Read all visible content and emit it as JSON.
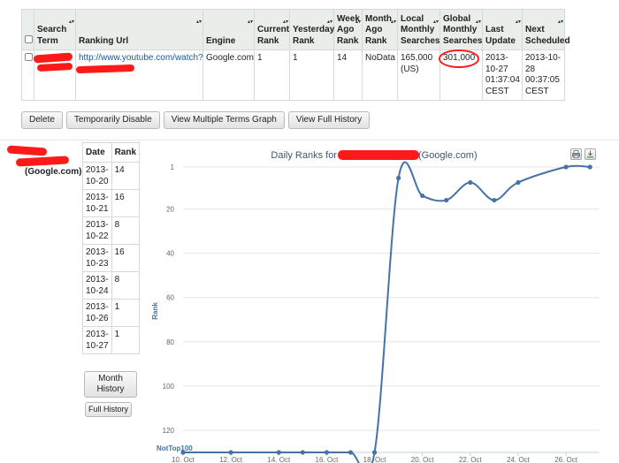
{
  "table": {
    "headers": {
      "search_term": "Search Term",
      "ranking_url": "Ranking Url",
      "engine": "Engine",
      "current_rank": "Current Rank",
      "yesterday_rank": "Yesterday Rank",
      "week_ago_rank": "Week Ago Rank",
      "month_ago_rank": "Month Ago Rank",
      "local_monthly": "Local Monthly Searches",
      "global_monthly": "Global Monthly Searches",
      "last_update": "Last Update",
      "next_scheduled": "Next Scheduled"
    },
    "row": {
      "ranking_url": "http://www.youtube.com/watch?",
      "engine": "Google.com",
      "current_rank": "1",
      "yesterday_rank": "1",
      "week_ago_rank": "14",
      "month_ago_rank": "NoData",
      "local_monthly": "165,000 (US)",
      "global_monthly": "301,000",
      "last_update": "2013-10-27 01:37:04 CEST",
      "next_scheduled": "2013-10-28 00:37:05 CEST"
    }
  },
  "actions": {
    "delete": "Delete",
    "disable": "Temporarily Disable",
    "multi_graph": "View Multiple Terms Graph",
    "full_history": "View Full History"
  },
  "left": {
    "engine_label": "(Google.com)",
    "history_headers": {
      "date": "Date",
      "rank": "Rank"
    },
    "history_rows": [
      {
        "date": "2013-10-20",
        "rank": "14"
      },
      {
        "date": "2013-10-21",
        "rank": "16"
      },
      {
        "date": "2013-10-22",
        "rank": "8"
      },
      {
        "date": "2013-10-23",
        "rank": "16"
      },
      {
        "date": "2013-10-24",
        "rank": "8"
      },
      {
        "date": "2013-10-26",
        "rank": "1"
      },
      {
        "date": "2013-10-27",
        "rank": "1"
      }
    ],
    "month_history": "Month History",
    "full_history": "Full History"
  },
  "colors": {
    "series": "#4572a7",
    "header_bg": "#e9eeea",
    "link": "#1a5aa0",
    "annotation": "#ff1a1a"
  },
  "chart_data": {
    "type": "line",
    "title_prefix": "Daily Ranks for",
    "title_suffix": "(Google.com)",
    "ylabel": "Rank",
    "y_reversed": true,
    "ylim": [
      1,
      130
    ],
    "y_ticks": [
      1,
      20,
      40,
      60,
      80,
      100,
      120
    ],
    "x_ticks": [
      {
        "day": 10,
        "label": "10. Oct"
      },
      {
        "day": 12,
        "label": "12. Oct"
      },
      {
        "day": 14,
        "label": "14. Oct"
      },
      {
        "day": 16,
        "label": "16. Oct"
      },
      {
        "day": 18,
        "label": "18. Oct"
      },
      {
        "day": 20,
        "label": "20. Oct"
      },
      {
        "day": 22,
        "label": "22. Oct"
      },
      {
        "day": 24,
        "label": "24. Oct"
      },
      {
        "day": 26,
        "label": "26. Oct"
      }
    ],
    "xlim": [
      10,
      27.4
    ],
    "not_top_label": "NotTop100",
    "series": [
      {
        "values": [
          {
            "day": 10,
            "rank": 130
          },
          {
            "day": 12,
            "rank": 130
          },
          {
            "day": 14,
            "rank": 130
          },
          {
            "day": 15,
            "rank": 130
          },
          {
            "day": 16,
            "rank": 130
          },
          {
            "day": 17,
            "rank": 130
          },
          {
            "day": 18,
            "rank": 130
          },
          {
            "day": 19,
            "rank": 6
          },
          {
            "day": 20,
            "rank": 14
          },
          {
            "day": 21,
            "rank": 16
          },
          {
            "day": 22,
            "rank": 8
          },
          {
            "day": 23,
            "rank": 16
          },
          {
            "day": 24,
            "rank": 8
          },
          {
            "day": 26,
            "rank": 1
          },
          {
            "day": 27,
            "rank": 1
          }
        ]
      }
    ]
  }
}
